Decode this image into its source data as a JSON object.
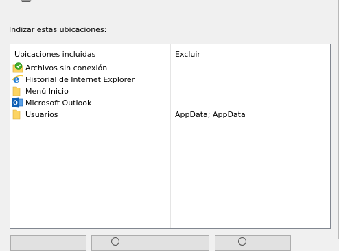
{
  "section_label": "Indizar estas ubicaciones:",
  "columns": {
    "included": "Ubicaciones incluidas",
    "exclude": "Excluir"
  },
  "locations": [
    {
      "name": "Archivos sin conexión",
      "icon": "offline-files-icon",
      "exclude": ""
    },
    {
      "name": "Historial de Internet Explorer",
      "icon": "internet-explorer-icon",
      "exclude": ""
    },
    {
      "name": "Menú Inicio",
      "icon": "folder-icon",
      "exclude": ""
    },
    {
      "name": "Microsoft Outlook",
      "icon": "outlook-icon",
      "exclude": ""
    },
    {
      "name": "Usuarios",
      "icon": "folder-icon",
      "exclude": "AppData; AppData"
    }
  ],
  "colors": {
    "window_bg": "#f0f0f0",
    "list_bg": "#ffffff",
    "list_border": "#828790",
    "folder_yellow": "#fcd462",
    "outlook_blue": "#0f5fb5",
    "ie_blue": "#1e7bd6",
    "offline_green": "#3fae2a"
  }
}
